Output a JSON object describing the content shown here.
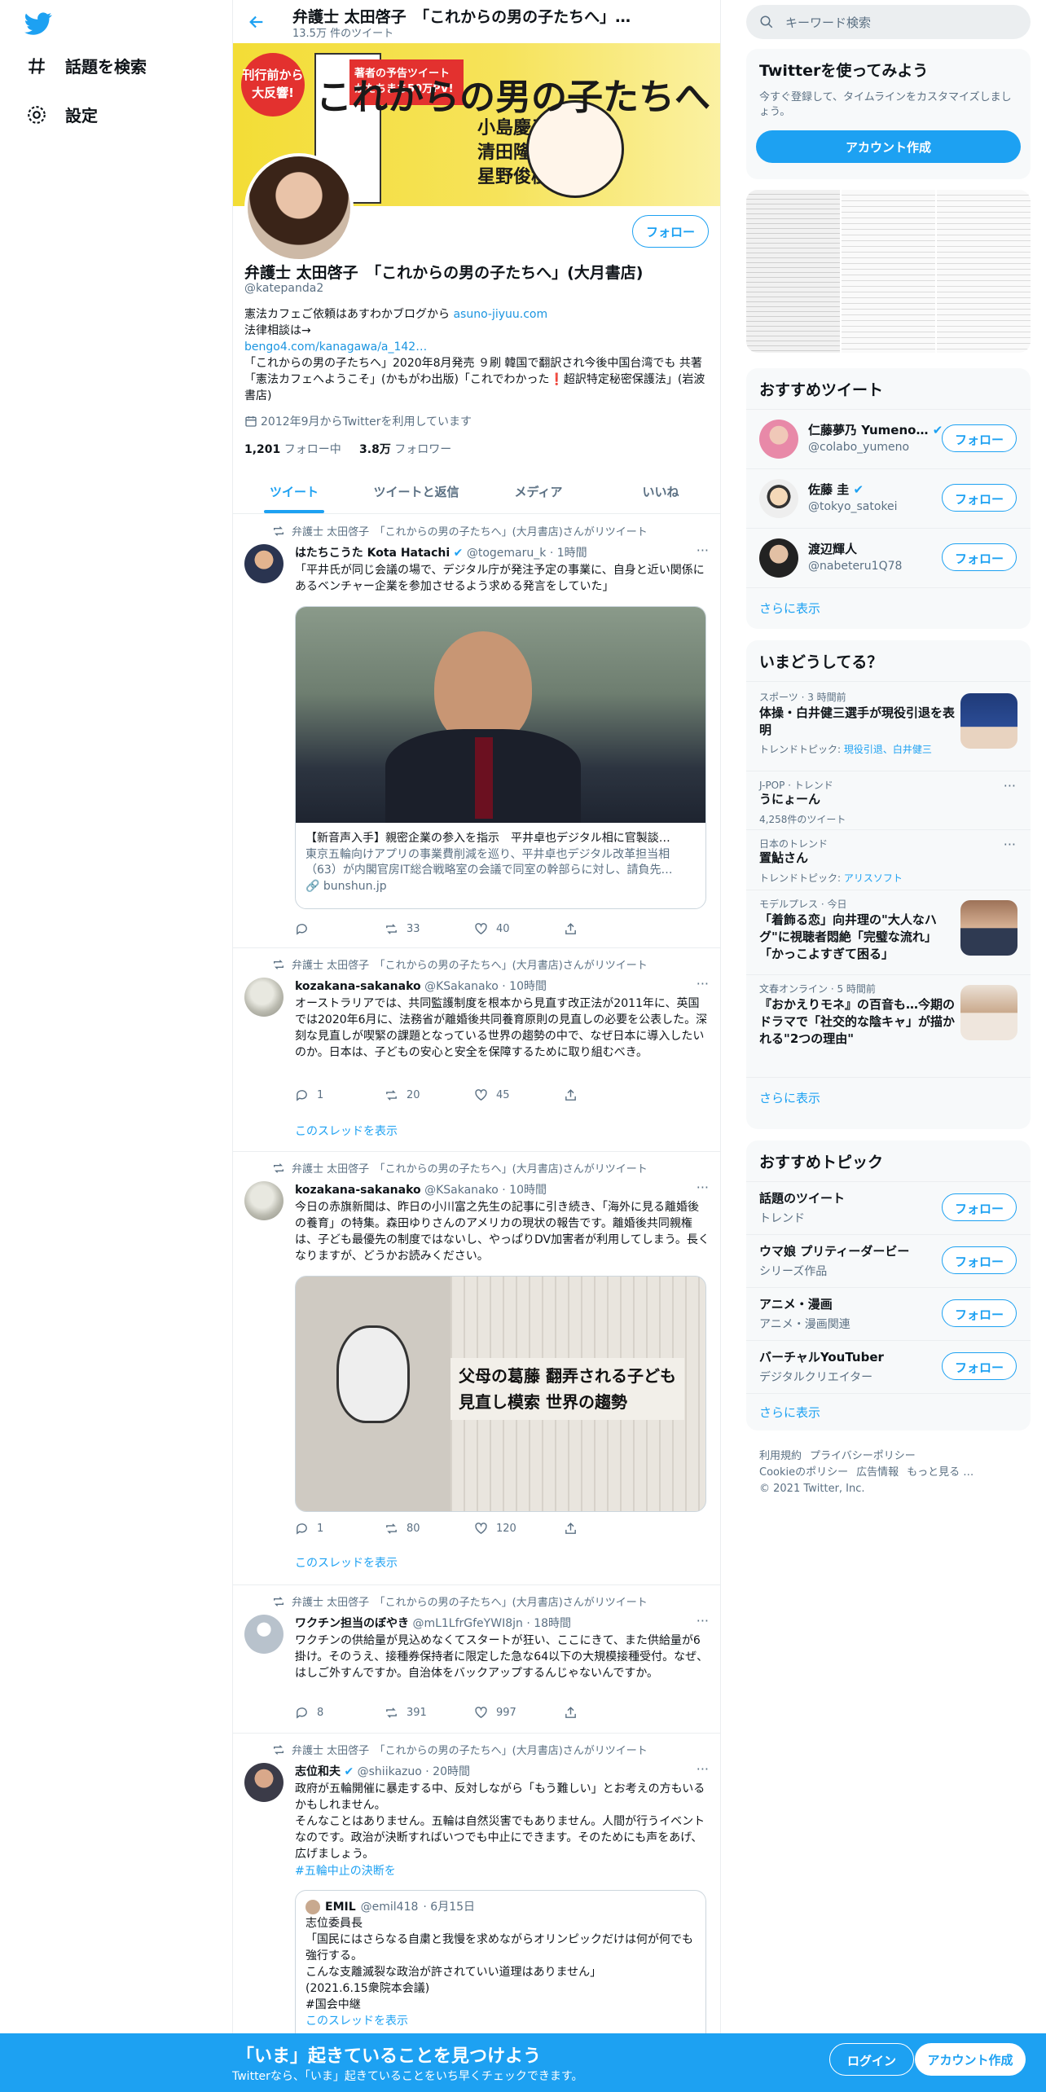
{
  "nav": {
    "explore_label": "話題を検索",
    "settings_label": "設定"
  },
  "header": {
    "title": "弁護士 太田啓子　「これからの男の子たちへ」…",
    "tweet_count": "13.5万 件のツイート"
  },
  "banner": {
    "headline": "これからの男の子たちへ",
    "badge": "刊行前から大反響!",
    "promo": "著者の予告ツイートがたちまち50万PV!",
    "names": [
      "小島慶子",
      "清田隆之",
      "星野俊樹"
    ],
    "author": "太田啓子"
  },
  "profile": {
    "name": "弁護士 太田啓子　「これからの男の子たちへ」(大月書店)",
    "handle": "@katepanda2",
    "follow_label": "フォロー",
    "bio_line1": "憲法カフェご依頼はあすわかブログから ",
    "bio_link1": "asuno-jiyuu.com",
    "bio_line2": "法律相談は→",
    "bio_link2": "bengo4.com/kanagawa/a_142…",
    "bio_line3": "「これからの男の子たちへ」2020年8月発売 ９刷 韓国で翻訳され今後中国台湾でも 共著「憲法カフェへようこそ」(かもがわ出版)「これでわかった❗️超訳特定秘密保護法」(岩波書店)",
    "joined": "2012年9月からTwitterを利用しています",
    "following_count": "1,201",
    "following_label": "フォロー中",
    "followers_count": "3.8万",
    "followers_label": "フォロワー"
  },
  "tabs": [
    "ツイート",
    "ツイートと返信",
    "メディア",
    "いいね"
  ],
  "tweets": [
    {
      "retweeted_by": "弁護士 太田啓子　「これからの男の子たちへ」(大月書店)さんがリツイート",
      "name": "はたちこうた Kota Hatachi",
      "handle": "@togemaru_k",
      "time": "· 1時間",
      "text": "「平井氏が同じ会議の場で、デジタル庁が発注予定の事業に、自身と近い関係にあるベンチャー企業を参加させるよう求める発言をしていた」",
      "card_title": "【新音声入手】親密企業の参入を指示　平井卓也デジタル相に官製談…",
      "card_desc": "東京五輪向けアプリの事業費削減を巡り、平井卓也デジタル改革担当相（63）が内閣官房IT総合戦略室の会議で同室の幹部らに対し、請負先…",
      "card_domain": "bunshun.jp",
      "replies": "",
      "retweets": "33",
      "likes": "40"
    },
    {
      "retweeted_by": "弁護士 太田啓子　「これからの男の子たちへ」(大月書店)さんがリツイート",
      "name": "kozakana-sakanako",
      "handle": "@KSakanako",
      "time": "· 10時間",
      "text": "オーストラリアでは、共同監護制度を根本から見直す改正法が2011年に、英国では2020年6月に、法務省が離婚後共同養育原則の見直しの必要を公表した。深刻な見直しが喫緊の課題となっている世界の趨勢の中で、なぜ日本に導入したいのか。日本は、子どもの安心と安全を保障するために取り組むべき。",
      "replies": "1",
      "retweets": "20",
      "likes": "45",
      "thread": "このスレッドを表示"
    },
    {
      "retweeted_by": "弁護士 太田啓子　「これからの男の子たちへ」(大月書店)さんがリツイート",
      "name": "kozakana-sakanako",
      "handle": "@KSakanako",
      "time": "· 10時間",
      "text": "今日の赤旗新聞は、昨日の小川富之先生の記事に引き続き、「海外に見る離婚後の養育」の特集。森田ゆりさんのアメリカの現状の報告です。離婚後共同親権は、子ども最優先の制度ではないし、やっぱりDV加害者が利用してしまう。長くなりますが、どうかお読みください。",
      "photo_headline1": "父母の葛藤 翻弄される子ども",
      "photo_headline2": "見直し模索 世界の趨勢",
      "replies": "1",
      "retweets": "80",
      "likes": "120",
      "thread": "このスレッドを表示"
    },
    {
      "retweeted_by": "弁護士 太田啓子　「これからの男の子たちへ」(大月書店)さんがリツイート",
      "name": "ワクチン担当のぼやき",
      "handle": "@mL1LfrGfeYWI8jn",
      "time": "· 18時間",
      "text": "ワクチンの供給量が見込めなくてスタートが狂い、ここにきて、また供給量が6掛け。そのうえ、接種券保持者に限定した急な64以下の大規模接種受付。なぜ、はしご外すんですか。自治体をバックアップするんじゃないんですか。",
      "replies": "8",
      "retweets": "391",
      "likes": "997"
    },
    {
      "retweeted_by": "弁護士 太田啓子　「これからの男の子たちへ」(大月書店)さんがリツイート",
      "name": "志位和夫",
      "handle": "@shiikazuo",
      "time": "· 20時間",
      "text": "政府が五輪開催に暴走する中、反対しながら「もう難しい」とお考えの方もいるかもしれません。\nそんなことはありません。五輪は自然災害でもありません。人間が行うイベントなのです。政治が決断すればいつでも中止にできます。そのためにも声をあげ、広げましょう。",
      "hashtag": "#五輪中止の決断を",
      "quote_name": "EMIL",
      "quote_handle": "@emil418",
      "quote_time": "· 6月15日",
      "quote_text": "志位委員長\n「国民にはさらなる自粛と我慢を求めながらオリンピックだけは何が何でも強行する。\nこんな支離滅裂な政治が許されていい道理はありません」\n(2021.6.15衆院本会議)\n#国会中継",
      "quote_thread": "このスレッドを表示"
    }
  ],
  "right": {
    "search_placeholder": "キーワード検索",
    "signup_box": {
      "title": "Twitterを使ってみよう",
      "desc": "今すぐ登録して、タイムラインをカスタマイズしましょう。",
      "button": "アカウント作成"
    },
    "recommended": {
      "title": "おすすめツイート",
      "follow_label": "フォロー",
      "users": [
        {
          "name": "仁藤夢乃 Yumeno…",
          "handle": "@colabo_yumeno"
        },
        {
          "name": "佐藤 圭",
          "handle": "@tokyo_satokei"
        },
        {
          "name": "渡辺輝人",
          "handle": "@nabeteru1Q78"
        }
      ],
      "more": "さらに表示"
    },
    "trends": {
      "title": "いまどうしてる？",
      "items": [
        {
          "meta": "スポーツ · 3 時間前",
          "title": "体操・白井健三選手が現役引退を表明",
          "sub_label": "トレンドトピック: ",
          "sub_link": "現役引退、白井健三"
        },
        {
          "meta": "J-POP · トレンド",
          "title": "うにょーん",
          "sub_label": "4,258件のツイート",
          "sub_link": ""
        },
        {
          "meta": "日本のトレンド",
          "title": "置鮎さん",
          "sub_label": "トレンドトピック: ",
          "sub_link": "アリスソフト"
        },
        {
          "meta": "モデルプレス · 今日",
          "title": "「着飾る恋」向井理の\"大人なハグ\"に視聴者悶絶「完璧な流れ」「かっこよすぎて困る」",
          "sub_label": "",
          "sub_link": ""
        },
        {
          "meta": "文春オンライン · 5 時間前",
          "title": "『おかえりモネ』の百音も…今期のドラマで「社交的な陰キャ」が描かれる\"2つの理由\"",
          "sub_label": "",
          "sub_link": ""
        }
      ],
      "more": "さらに表示"
    },
    "topics": {
      "title": "おすすめトピック",
      "follow_label": "フォロー",
      "items": [
        {
          "name": "話題のツイート",
          "sub": "トレンド"
        },
        {
          "name": "ウマ娘 プリティーダービー",
          "sub": "シリーズ作品"
        },
        {
          "name": "アニメ・漫画",
          "sub": "アニメ・漫画関連"
        },
        {
          "name": "バーチャルYouTuber",
          "sub": "デジタルクリエイター"
        }
      ],
      "more": "さらに表示"
    },
    "footer": {
      "links": [
        "利用規約",
        "プライバシーポリシー",
        "Cookieのポリシー",
        "広告情報",
        "もっと見る …"
      ],
      "copyright": "© 2021 Twitter, Inc."
    }
  },
  "bottom": {
    "heading": "「いま」起きていることを見つけよう",
    "sub": "Twitterなら、「いま」起きていることをいち早くチェックできます。",
    "login": "ログイン",
    "signup": "アカウント作成"
  },
  "colors": {
    "accent": "#1da1f2",
    "bottom_bar": "#1da1f2",
    "banner_yellow": "#f3dd36"
  }
}
